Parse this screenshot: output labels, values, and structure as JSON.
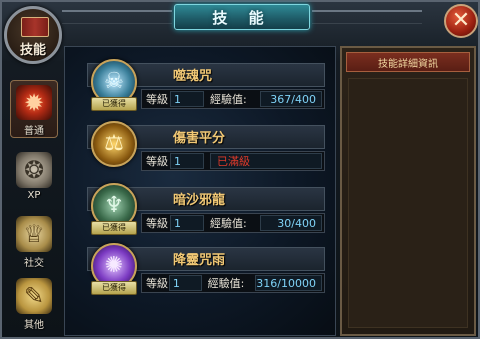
{
  "window": {
    "title": "技 能",
    "close_label": "✕"
  },
  "badge": {
    "label": "技能"
  },
  "sidebar": {
    "tabs": [
      {
        "label": "普通",
        "icon": "burst-icon",
        "active": true
      },
      {
        "label": "XP",
        "icon": "swirl-icon",
        "active": false
      },
      {
        "label": "社交",
        "icon": "chalice-icon",
        "active": false
      },
      {
        "label": "其他",
        "icon": "scroll-icon",
        "active": false
      }
    ]
  },
  "labels": {
    "level": "等級",
    "exp": "經驗值:"
  },
  "skills": [
    {
      "name": "噬魂咒",
      "level": "1",
      "exp": "367/400",
      "tag": "已獲得",
      "icon": "ghost-icon",
      "color": "#3a7f9a"
    },
    {
      "name": "傷害平分",
      "level": "1",
      "exp": "已滿級",
      "tag": "",
      "icon": "scales-icon",
      "color": "#8a5a10"
    },
    {
      "name": "暗沙邪龍",
      "level": "1",
      "exp": "30/400",
      "tag": "已獲得",
      "icon": "dragon-icon",
      "color": "#3a6a4a"
    },
    {
      "name": "降靈咒雨",
      "level": "1",
      "exp": "316/10000",
      "tag": "已獲得",
      "icon": "vortex-icon",
      "color": "#7b3ac2"
    }
  ],
  "detail": {
    "header": "技能詳細資訊"
  },
  "colors": {
    "accent": "#2f8a96",
    "gold": "#f1c875",
    "value": "#7fd2f6",
    "max": "#e03a2a"
  }
}
